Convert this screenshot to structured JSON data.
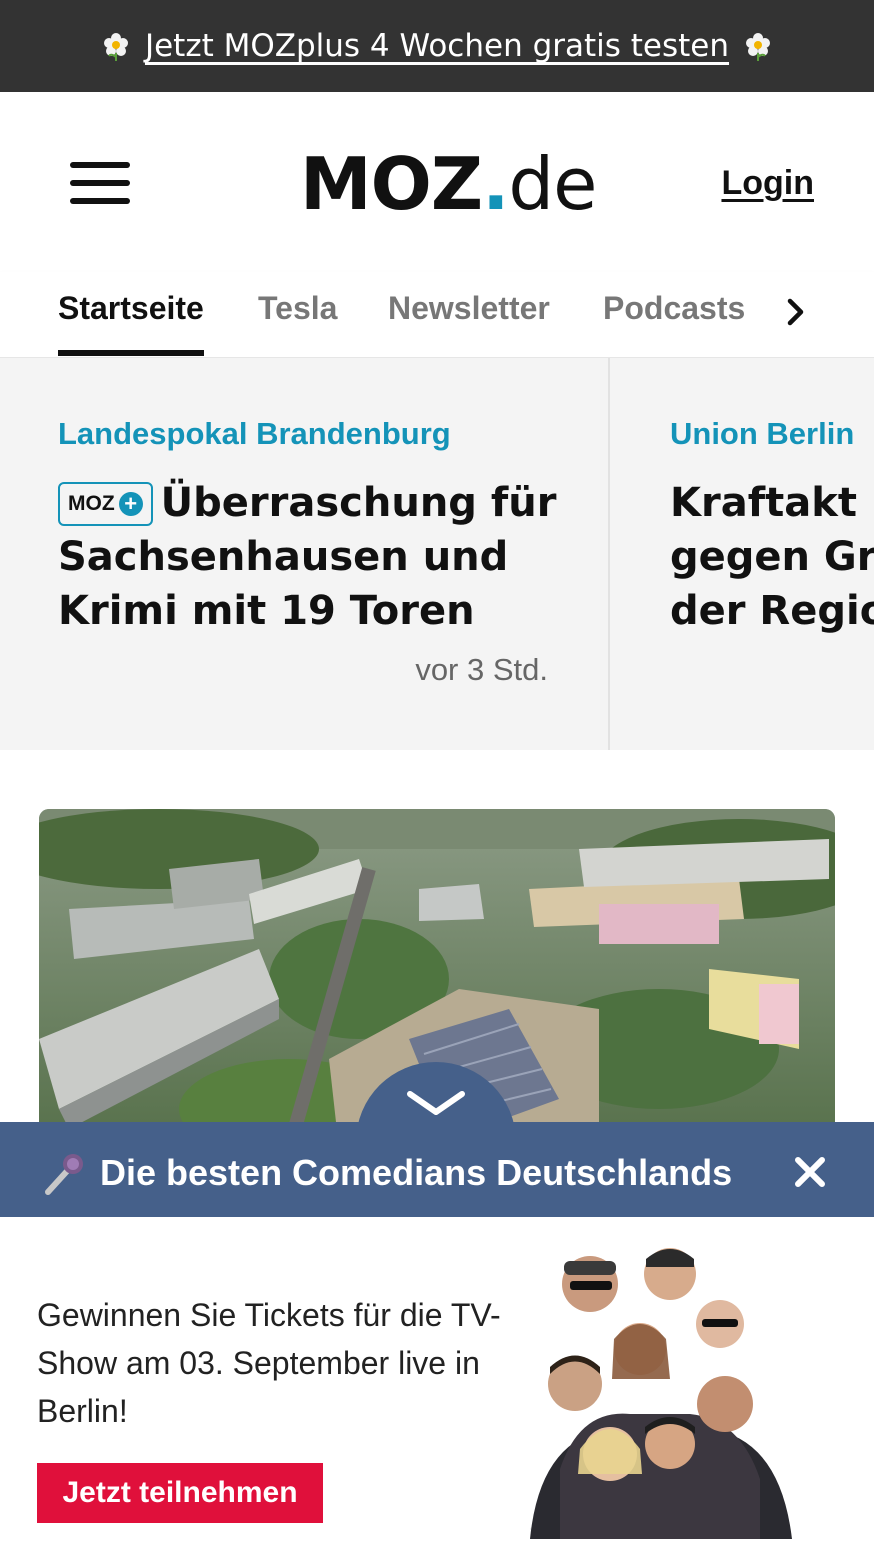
{
  "promo": {
    "label": "Jetzt MOZplus 4 Wochen gratis testen",
    "icon": "flower-icon"
  },
  "header": {
    "logo_main": "MOZ",
    "logo_dot": ".",
    "logo_tld": "de",
    "login_label": "Login"
  },
  "nav": {
    "tabs": [
      {
        "label": "Startseite",
        "active": true
      },
      {
        "label": "Tesla",
        "active": false
      },
      {
        "label": "Newsletter",
        "active": false
      },
      {
        "label": "Podcasts",
        "active": false
      }
    ]
  },
  "teasers": [
    {
      "kicker": "Landespokal Brandenburg",
      "badge": "MOZ",
      "badge_plus": "+",
      "headline": "Überraschung für Sachsenhausen und Krimi mit 19 Toren",
      "time": "vor 3 Std."
    },
    {
      "kicker": "Union Berlin",
      "headline_lines": [
        "Kraftakt im",
        "gegen Gre",
        "der Region"
      ]
    }
  ],
  "ad": {
    "title": "Die besten Comedians Deutschlands",
    "text": "Gewinnen Sie Tickets für die TV-Show am 03. September live in Berlin!",
    "cta_label": "Jetzt teilnehmen"
  },
  "colors": {
    "accent": "#1493b8",
    "promo_bg": "#333333",
    "ad_bar": "#45608a",
    "cta": "#e0103b"
  }
}
